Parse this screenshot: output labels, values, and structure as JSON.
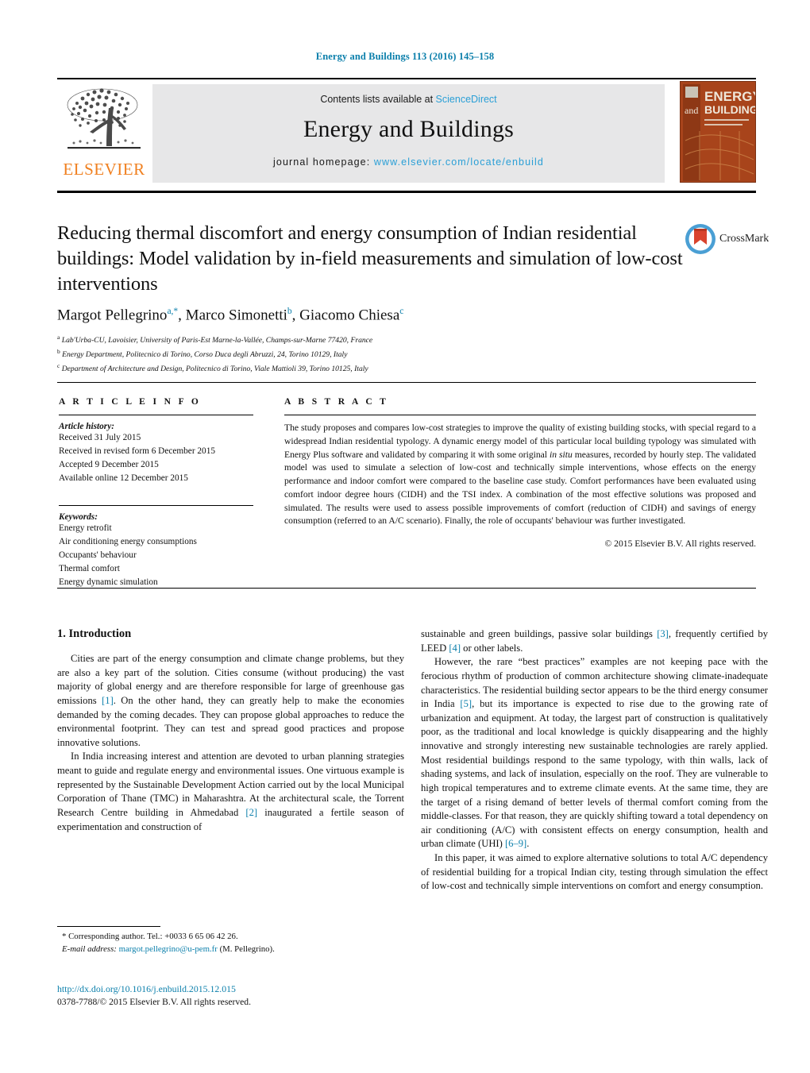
{
  "running_head": "Energy and Buildings 113 (2016) 145–158",
  "masthead": {
    "contents_prefix": "Contents lists available at ",
    "sciencedirect": "ScienceDirect",
    "journal_title": "Energy and Buildings",
    "homepage_prefix": "journal homepage: ",
    "homepage_url": "www.elsevier.com/locate/enbuild",
    "publisher_wordmark": "ELSEVIER",
    "cover_line1": "ENERGY",
    "cover_line2": "and",
    "cover_line3": "BUILDINGS",
    "colors": {
      "link": "#2a9fd6",
      "elsevier_orange": "#f08020",
      "panel_grey": "#e7e7e8",
      "cover_orange": "#a8441b"
    }
  },
  "article": {
    "title": "Reducing thermal discomfort and energy consumption of Indian residential buildings: Model validation by in-field measurements and simulation of low-cost interventions",
    "crossmark_label": "CrossMark",
    "authors_html": "Margot Pellegrino<sup>a,*</sup>, Marco Simonetti<sup>b</sup>, Giacomo Chiesa<sup>c</sup>",
    "affiliations": [
      {
        "marker": "a",
        "text": "Lab'Urba-CU, Lavoisier, University of Paris-Est Marne-la-Vallée, Champs-sur-Marne 77420, France"
      },
      {
        "marker": "b",
        "text": "Energy Department, Politecnico di Torino, Corso Duca degli Abruzzi, 24, Torino 10129, Italy"
      },
      {
        "marker": "c",
        "text": "Department of Architecture and Design, Politecnico di Torino, Viale Mattioli 39, Torino 10125, Italy"
      }
    ]
  },
  "article_info": {
    "heading": "A R T I C L E   I N F O",
    "history_label": "Article history:",
    "history": [
      "Received 31 July 2015",
      "Received in revised form 6 December 2015",
      "Accepted 9 December 2015",
      "Available online 12 December 2015"
    ],
    "keywords_label": "Keywords:",
    "keywords": [
      "Energy retrofit",
      "Air conditioning energy consumptions",
      "Occupants' behaviour",
      "Thermal comfort",
      "Energy dynamic simulation"
    ]
  },
  "abstract": {
    "heading": "A B S T R A C T",
    "text_html": "The study proposes and compares low-cost strategies to improve the quality of existing building stocks, with special regard to a widespread Indian residential typology. A dynamic energy model of this particular local building typology was simulated with Energy Plus software and validated by comparing it with some original <i>in situ</i> measures, recorded by hourly step. The validated model was used to simulate a selection of low-cost and technically simple interventions, whose effects on the energy performance and indoor comfort were compared to the baseline case study. Comfort performances have been evaluated using comfort indoor degree hours (CIDH) and the TSI index. A combination of the most effective solutions was proposed and simulated. The results were used to assess possible improvements of comfort (reduction of CIDH) and savings of energy consumption (referred to an A/C scenario). Finally, the role of occupants' behaviour was further investigated.",
    "copyright": "© 2015 Elsevier B.V. All rights reserved."
  },
  "body": {
    "section_heading": "1.  Introduction",
    "left_paragraphs_html": [
      "Cities are part of the energy consumption and climate change problems, but they are also a key part of the solution. Cities consume (without producing) the vast majority of global energy and are therefore responsible for large of greenhouse gas emissions <span class=\"ref\">[1]</span>. On the other hand, they can greatly help to make the economies demanded by the coming decades. They can propose global approaches to reduce the environmental footprint. They can test and spread good practices and propose innovative solutions.",
      "In India increasing interest and attention are devoted to urban planning strategies meant to guide and regulate energy and environmental issues. One virtuous example is represented by the Sustainable Development Action carried out by the local Municipal Corporation of Thane (TMC) in Maharashtra. At the architectural scale, the Torrent Research Centre building in Ahmedabad <span class=\"ref\">[2]</span> inaugurated a fertile season of experimentation and construction of"
    ],
    "right_paragraphs_html": [
      "sustainable and green buildings, passive solar buildings <span class=\"ref\">[3]</span>, frequently certified by LEED <span class=\"ref\">[4]</span> or other labels.",
      "However, the rare “best practices” examples are not keeping pace with the ferocious rhythm of production of common architecture showing climate-inadequate characteristics. The residential building sector appears to be the third energy consumer in India <span class=\"ref\">[5]</span>, but its importance is expected to rise due to the growing rate of urbanization and equipment. At today, the largest part of construction is qualitatively poor, as the traditional and local knowledge is quickly disappearing and the highly innovative and strongly interesting new sustainable technologies are rarely applied. Most residential buildings respond to the same typology, with thin walls, lack of shading systems, and lack of insulation, especially on the roof. They are vulnerable to high tropical temperatures and to extreme climate events. At the same time, they are the target of a rising demand of better levels of thermal comfort coming from the middle-classes. For that reason, they are quickly shifting toward a total dependency on air conditioning (A/C) with consistent effects on energy consumption, health and urban climate (UHI) <span class=\"ref\">[6–9]</span>.",
      "In this paper, it was aimed to explore alternative solutions to total A/C dependency of residential building for a tropical Indian city, testing through simulation the effect of low-cost and technically simple interventions on comfort and energy consumption."
    ],
    "right_first_is_continuation": true
  },
  "footnote": {
    "corresponding_html": "* Corresponding author. Tel.: +0033 6 65 06 42 26.",
    "email_label": "E-mail address:",
    "email": "margot.pellegrino@u-pem.fr",
    "email_suffix": "(M. Pellegrino)."
  },
  "footer": {
    "doi": "http://dx.doi.org/10.1016/j.enbuild.2015.12.015",
    "issn_line": "0378-7788/© 2015 Elsevier B.V. All rights reserved."
  }
}
